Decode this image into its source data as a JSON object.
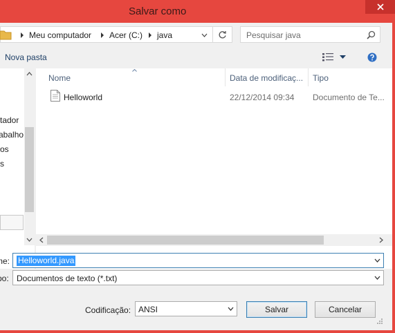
{
  "window": {
    "title": "Salvar como",
    "accent": "#e6473f"
  },
  "address": {
    "crumbs": [
      "Meu computador",
      "Acer (C:)",
      "java"
    ]
  },
  "search": {
    "placeholder": "Pesquisar java"
  },
  "toolbar": {
    "new_folder_label": "Nova pasta"
  },
  "nav": {
    "items": [
      "tador",
      "abalho",
      "os",
      "s"
    ]
  },
  "files": {
    "columns": [
      "Nome",
      "Data de modificaç...",
      "Tipo"
    ],
    "rows": [
      {
        "name": "Helloworld",
        "date": "22/12/2014 09:34",
        "type": "Documento de Te..."
      }
    ]
  },
  "form": {
    "name_label": "me:",
    "file_name": "Helloworld.java",
    "type_label": "po:",
    "file_type": "Documentos de texto (*.txt)",
    "encoding_label": "Codificação:",
    "encoding_value": "ANSI",
    "save_label": "Salvar",
    "cancel_label": "Cancelar"
  }
}
